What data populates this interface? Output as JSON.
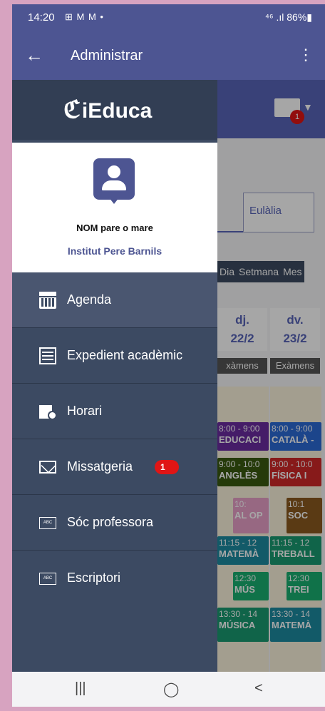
{
  "status": {
    "time": "14:20",
    "left_icons": "⊞ M M •",
    "right": "⁴⁶ .ıl 86%▮"
  },
  "appbar": {
    "title": "Administrar"
  },
  "background": {
    "mail_badge": "1",
    "tab_label": "Eulàlia",
    "view_buttons": [
      "Dia",
      "Setmana",
      "Mes"
    ],
    "days": [
      {
        "name": "dj.",
        "date": "22/2"
      },
      {
        "name": "dv.",
        "date": "23/2"
      }
    ],
    "exam_labels": [
      "xàmens",
      "Exàmens"
    ],
    "cells": [
      {
        "time": "8:00 - 9:00",
        "subject": "EDUCACI",
        "color": "#6a2ca0"
      },
      {
        "time": "8:00 - 9:00",
        "subject": "CATALÀ -",
        "color": "#2c6ad6"
      },
      {
        "time": "9:00 - 10:0",
        "subject": "ANGLÈS",
        "color": "#3a5a10"
      },
      {
        "time": "9:00 - 10:0",
        "subject": "FÍSICA I",
        "color": "#d02828"
      },
      {
        "time": "10:",
        "subject": "AL OP",
        "color": "#e9a0c8"
      },
      {
        "time": "10:1",
        "subject": "SOC",
        "color": "#8a5a20"
      },
      {
        "time": "11:15 - 12",
        "subject": "MATEMÀ",
        "color": "#1c8aa0"
      },
      {
        "time": "11:15 - 12",
        "subject": "TREBALL",
        "color": "#1a9a70"
      },
      {
        "time": "12:30",
        "subject": "MÚS",
        "color": "#1ab070"
      },
      {
        "time": "12:30",
        "subject": "TREI",
        "color": "#1ab070"
      },
      {
        "time": "13:30 - 14",
        "subject": "MÚSICA",
        "color": "#1a9a70"
      },
      {
        "time": "13:30 - 14",
        "subject": "MATEMÀ",
        "color": "#1c8aa0"
      }
    ]
  },
  "drawer": {
    "brand": "iEduca",
    "profile_name": "NOM pare o mare",
    "profile_school": "Institut Pere Barnils",
    "items": [
      {
        "label": "Agenda",
        "icon": "calendar-icon",
        "active": true
      },
      {
        "label": "Expedient acadèmic",
        "icon": "list-icon"
      },
      {
        "label": "Horari",
        "icon": "schedule-icon"
      },
      {
        "label": "Missatgeria",
        "icon": "envelope-icon",
        "badge": "1"
      },
      {
        "label": "Sóc professora",
        "icon": "abc-icon",
        "icon_text": "ABC"
      },
      {
        "label": "Escriptori",
        "icon": "abc-icon",
        "icon_text": "ABC"
      }
    ]
  },
  "navbar": {
    "recent": "|||",
    "home": "◯",
    "back": "<"
  }
}
